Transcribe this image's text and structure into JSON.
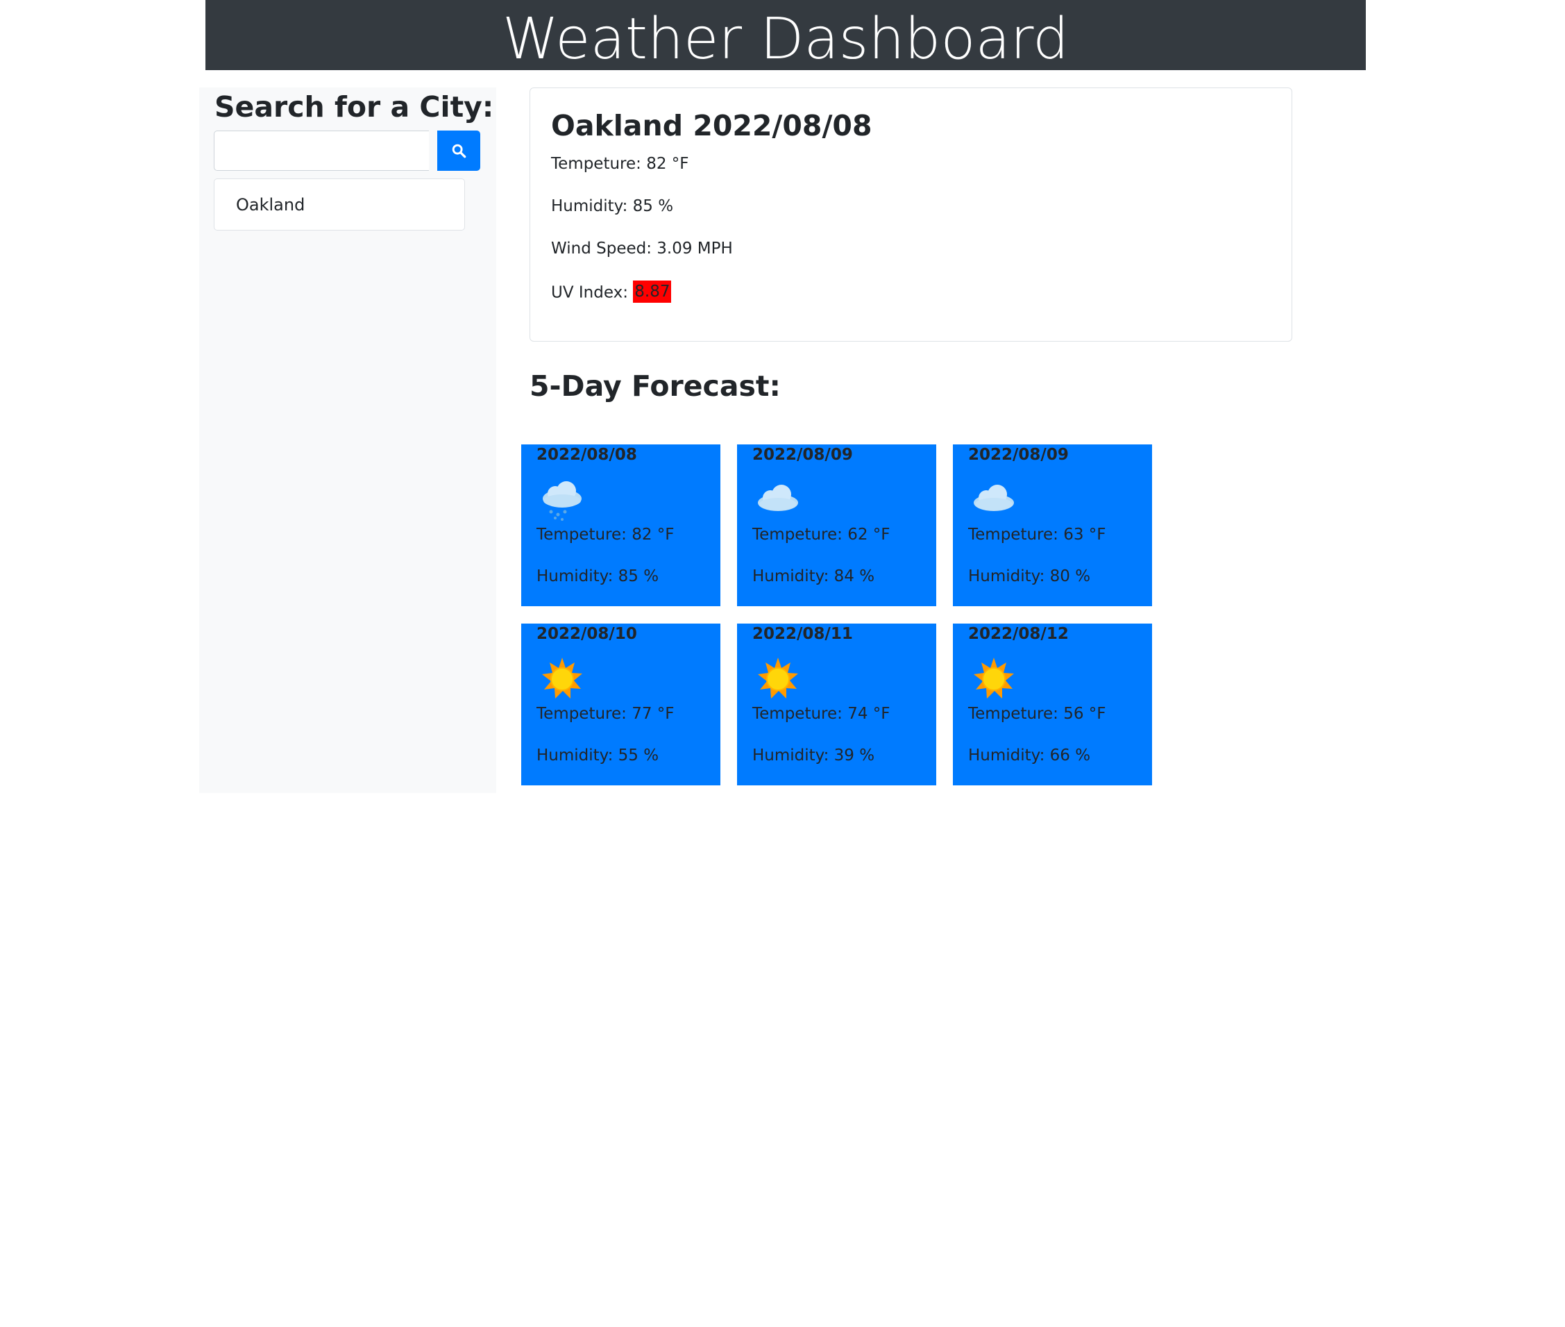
{
  "header": {
    "title": "Weather Dashboard"
  },
  "sidebar": {
    "search_title": "Search for a City:",
    "search_input": {
      "value": "",
      "placeholder": ""
    },
    "search_button_icon": "search-icon",
    "history": [
      "Oakland"
    ]
  },
  "current": {
    "title": "Oakland 2022/08/08",
    "temperature": "Tempeture: 82 °F",
    "humidity": "Humidity: 85 %",
    "wind": "Wind Speed: 3.09 MPH",
    "uv_label": "UV Index: ",
    "uv_value": "8.87",
    "uv_color": "#ff0000"
  },
  "forecast_title": "5-Day Forecast:",
  "forecast": [
    {
      "date": "2022/08/08",
      "icon": "rain-cloud",
      "temp": "Tempeture: 82 °F",
      "humidity": "Humidity: 85 %"
    },
    {
      "date": "2022/08/09",
      "icon": "cloud",
      "temp": "Tempeture: 62 °F",
      "humidity": "Humidity: 84 %"
    },
    {
      "date": "2022/08/09",
      "icon": "cloud",
      "temp": "Tempeture: 63 °F",
      "humidity": "Humidity: 80 %"
    },
    {
      "date": "2022/08/10",
      "icon": "sun",
      "temp": "Tempeture: 77 °F",
      "humidity": "Humidity: 55 %"
    },
    {
      "date": "2022/08/11",
      "icon": "sun",
      "temp": "Tempeture: 74 °F",
      "humidity": "Humidity: 39 %"
    },
    {
      "date": "2022/08/12",
      "icon": "sun",
      "temp": "Tempeture: 56 °F",
      "humidity": "Humidity: 66 %"
    }
  ],
  "colors": {
    "header_bg": "#343a40",
    "accent": "#007bff",
    "sidebar_bg": "#f8f9fa"
  }
}
